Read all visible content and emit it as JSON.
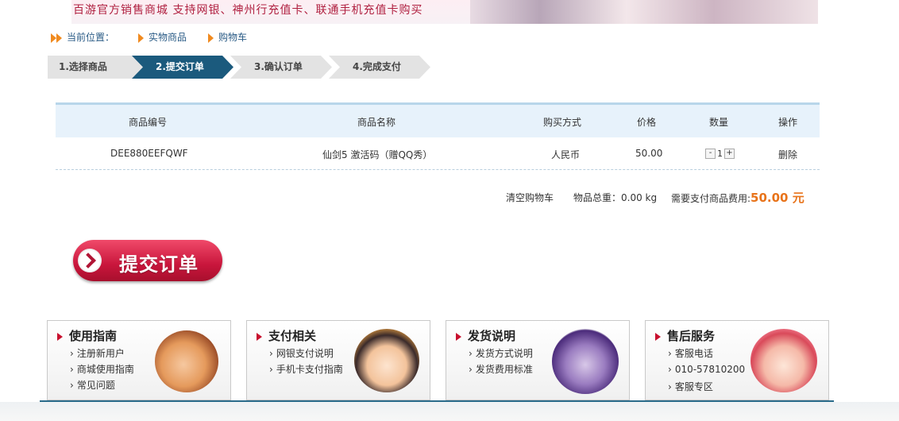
{
  "banner": {
    "text": "百游官方销售商城 支持网银、神州行充值卡、联通手机充值卡购买"
  },
  "breadcrumb": {
    "prefix": "当前位置：",
    "items": [
      "实物商品",
      "购物车"
    ]
  },
  "steps": [
    "1.选择商品",
    "2.提交订单",
    "3.确认订单",
    "4.完成支付"
  ],
  "active_step": 2,
  "cart": {
    "headers": [
      "商品编号",
      "商品名称",
      "购买方式",
      "价格",
      "数量",
      "操作"
    ],
    "rows": [
      {
        "id": "DEE880EEFQWF",
        "name": "仙剑5 激活码（赠QQ秀）",
        "method": "人民币",
        "price": "50.00",
        "qty": "1",
        "action": "删除",
        "minus": "-",
        "plus": "+"
      }
    ]
  },
  "summary": {
    "clear": "清空购物车",
    "weight_label": "物品总重：",
    "weight_value": "0.00 kg",
    "fee_label": "需要支付商品费用:",
    "fee_value": "50.00 元"
  },
  "submit_label": "提交订单",
  "help": [
    {
      "title": "使用指南",
      "links": [
        "注册新用户",
        "商城使用指南",
        "常见问题"
      ]
    },
    {
      "title": "支付相关",
      "links": [
        "网银支付说明",
        "手机卡支付指南"
      ]
    },
    {
      "title": "发货说明",
      "links": [
        "发货方式说明",
        "发货费用标准"
      ]
    },
    {
      "title": "售后服务",
      "links": [
        "客服电话",
        "010-57810200",
        "客服专区"
      ]
    }
  ],
  "colors": {
    "accent": "#1b5a7d",
    "price": "#e8731a",
    "submit": "#c9163c"
  }
}
